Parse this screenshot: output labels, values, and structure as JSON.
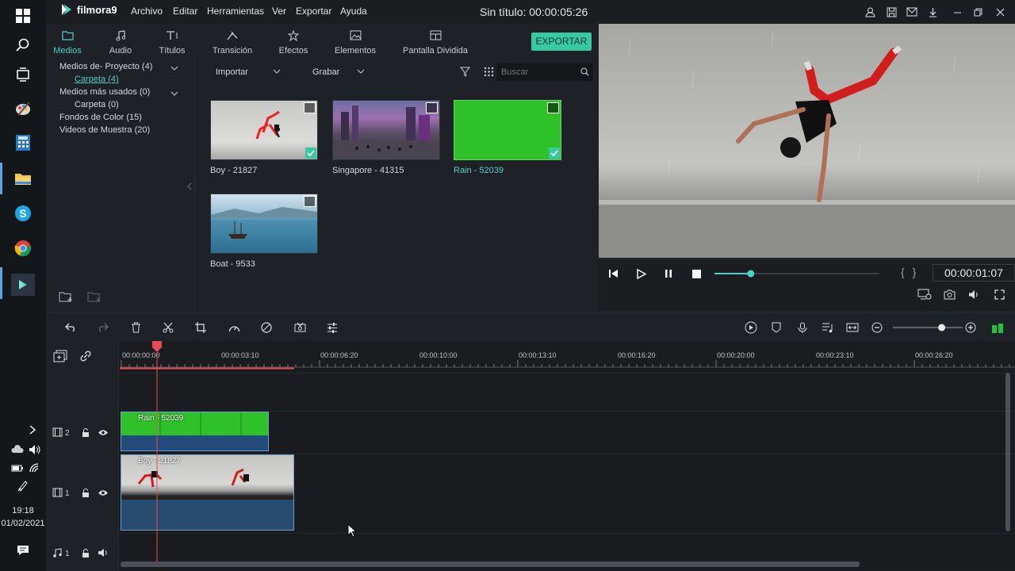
{
  "app": {
    "name": "filmora9",
    "title": "Sin título:",
    "duration": "00:00:05:26"
  },
  "menu": [
    "Archivo",
    "Editar",
    "Herramientas",
    "Ver",
    "Exportar",
    "Ayuda"
  ],
  "tabs": [
    {
      "label": "Medios",
      "icon": "folder-icon",
      "active": true
    },
    {
      "label": "Audio",
      "icon": "music-note-icon"
    },
    {
      "label": "Títulos",
      "icon": "text-icon"
    },
    {
      "label": "Transición",
      "icon": "transition-icon"
    },
    {
      "label": "Efectos",
      "icon": "effects-icon"
    },
    {
      "label": "Elementos",
      "icon": "image-icon"
    },
    {
      "label": "Pantalla Dividida",
      "icon": "split-screen-icon"
    }
  ],
  "export_label": "EXPORTAR",
  "library_tree": [
    {
      "label": "Medios de- Proyecto (4)",
      "level": 0,
      "expandable": true
    },
    {
      "label": "Carpeta (4)",
      "level": 1,
      "selected": true
    },
    {
      "label": "Medios más usados (0)",
      "level": 0,
      "expandable": true
    },
    {
      "label": "Carpeta (0)",
      "level": 1
    },
    {
      "label": "Fondos de Color (15)",
      "level": 0
    },
    {
      "label": "Videos de Muestra (20)",
      "level": 0
    }
  ],
  "media_toolbar": {
    "import_label": "Importar",
    "record_label": "Grabar",
    "search_placeholder": "Buscar"
  },
  "media_items": [
    {
      "name": "Boy - 21827",
      "checked": true,
      "selected": false
    },
    {
      "name": "Singapore - 41315",
      "checked": false,
      "selected": false
    },
    {
      "name": "Rain - 52039",
      "checked": true,
      "selected": true
    },
    {
      "name": "Boat - 9533",
      "checked": false,
      "selected": false
    }
  ],
  "preview": {
    "current_time": "00:00:01:07",
    "progress": 0.22,
    "markers": "{ }"
  },
  "timeline": {
    "ruler": [
      "00:00:00:00",
      "00:00:03:10",
      "00:00:06:20",
      "00:00:10:00",
      "00:00:13:10",
      "00:00:16:20",
      "00:00:20:00",
      "00:00:23:10",
      "00:00:26:20"
    ],
    "zoom_level": 0.7,
    "tracks": [
      {
        "number": "2",
        "clip": "Rain - 52039"
      },
      {
        "number": "1",
        "clip": "Boy - 21827"
      },
      {
        "number": "1",
        "type": "audio"
      }
    ]
  },
  "system": {
    "time": "19:18",
    "date": "01/02/2021"
  },
  "colors": {
    "accent": "#37c9a2",
    "selected_text": "#4fd1c5",
    "playhead": "#e84b55",
    "clip_border": "#6b9fd0"
  }
}
